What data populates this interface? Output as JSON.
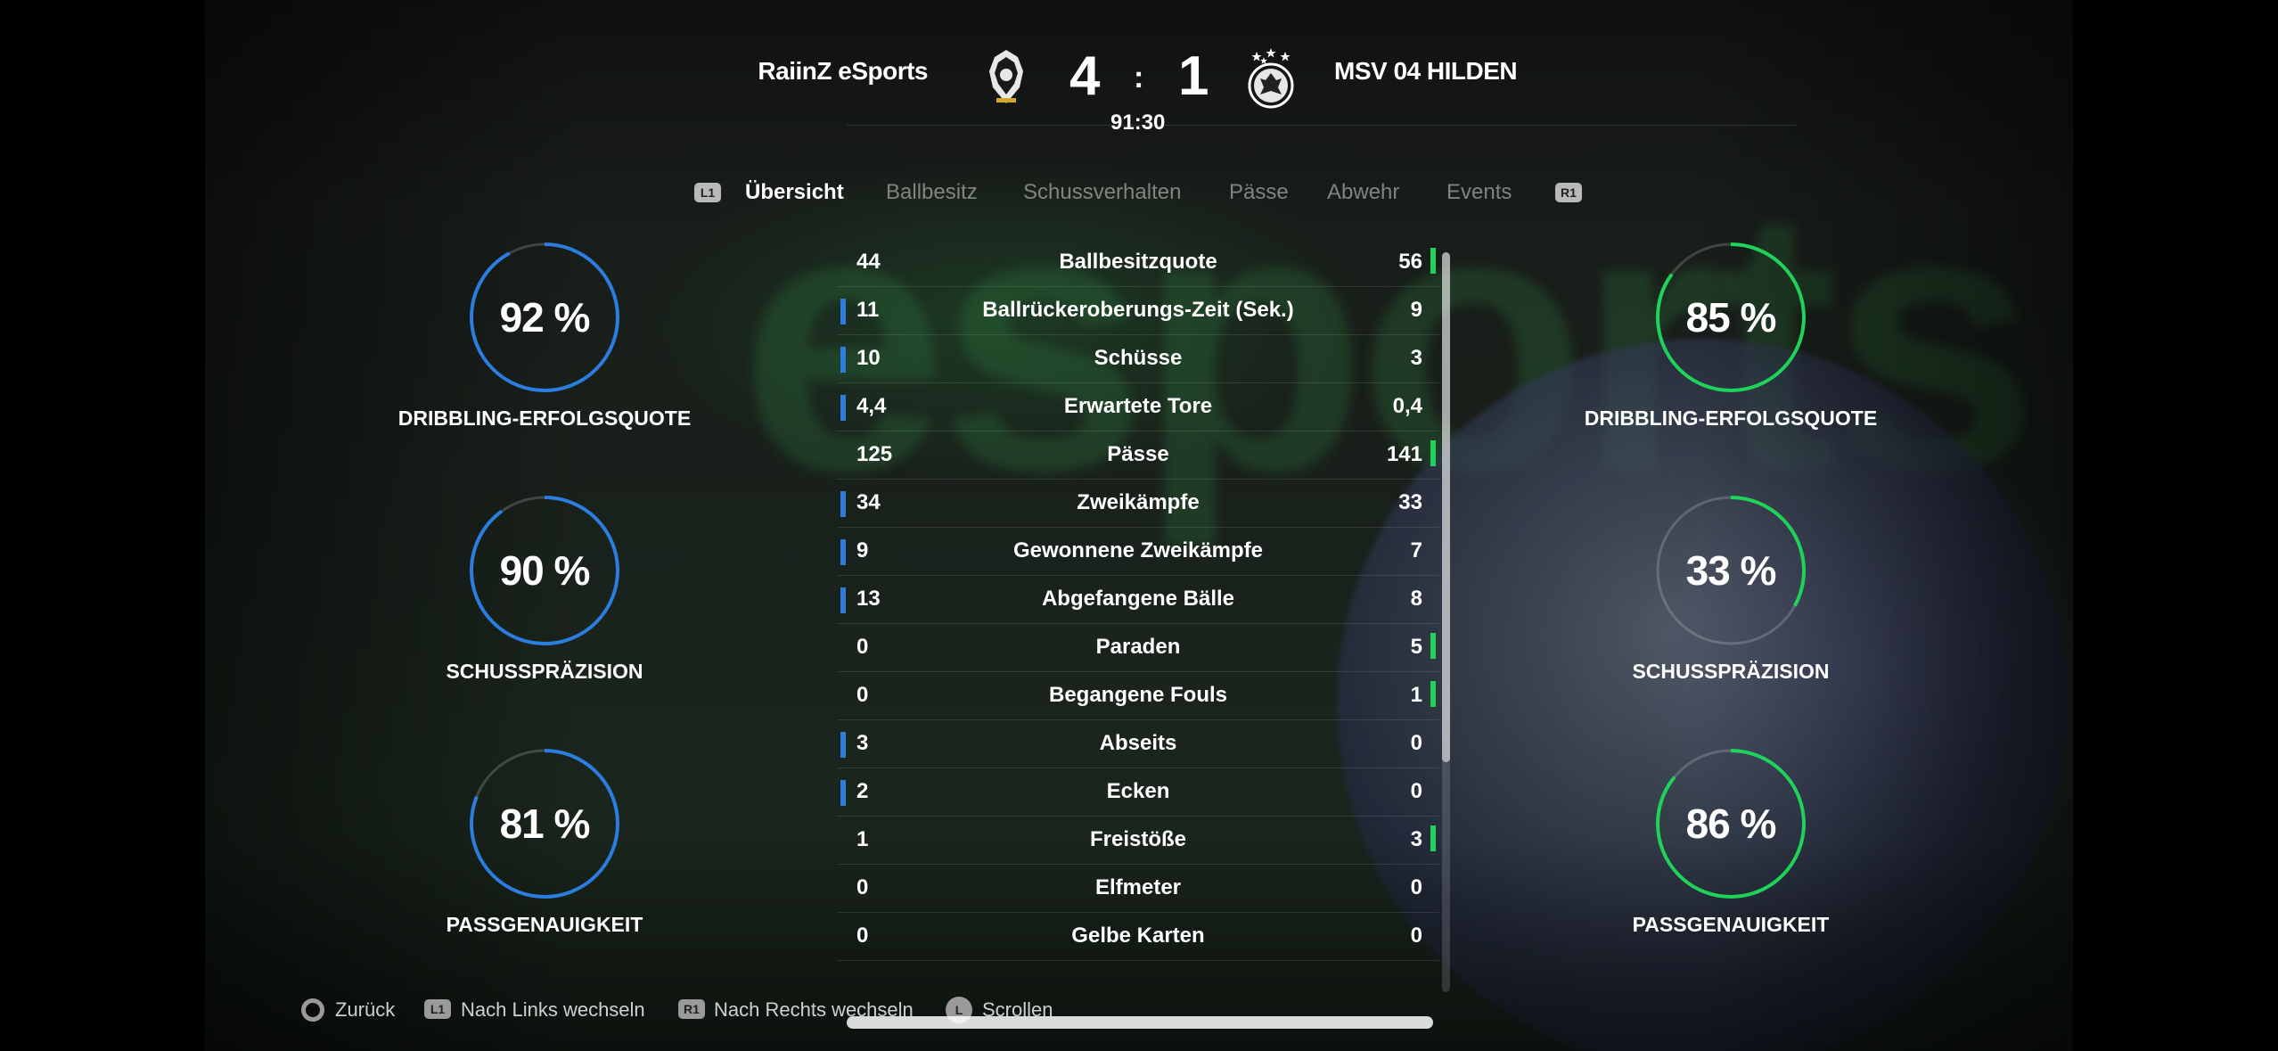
{
  "header": {
    "home_team": "RaiinZ eSports",
    "away_team": "MSV 04 HILDEN",
    "home_score": "4",
    "away_score": "1",
    "separator": ":",
    "clock": "91:30"
  },
  "tabs": {
    "left_button": "L1",
    "right_button": "R1",
    "items": [
      "Übersicht",
      "Ballbesitz",
      "Schussverhalten",
      "Pässe",
      "Abwehr",
      "Events"
    ],
    "active": "Übersicht"
  },
  "left_rings": [
    {
      "value": "92 %",
      "fraction": 0.92,
      "label": "DRIBBLING-ERFOLGSQUOTE"
    },
    {
      "value": "90 %",
      "fraction": 0.9,
      "label": "SCHUSSPRÄZISION"
    },
    {
      "value": "81 %",
      "fraction": 0.81,
      "label": "PASSGENAUIGKEIT"
    }
  ],
  "right_rings": [
    {
      "value": "85 %",
      "fraction": 0.85,
      "label": "DRIBBLING-ERFOLGSQUOTE"
    },
    {
      "value": "33 %",
      "fraction": 0.33,
      "label": "SCHUSSPRÄZISION"
    },
    {
      "value": "86 %",
      "fraction": 0.86,
      "label": "PASSGENAUIGKEIT"
    }
  ],
  "stats": [
    {
      "home": "44",
      "name": "Ballbesitzquote",
      "away": "56",
      "leader": "away"
    },
    {
      "home": "11",
      "name": "Ballrückeroberungs-Zeit (Sek.)",
      "away": "9",
      "leader": "home"
    },
    {
      "home": "10",
      "name": "Schüsse",
      "away": "3",
      "leader": "home"
    },
    {
      "home": "4,4",
      "name": "Erwartete Tore",
      "away": "0,4",
      "leader": "home"
    },
    {
      "home": "125",
      "name": "Pässe",
      "away": "141",
      "leader": "away"
    },
    {
      "home": "34",
      "name": "Zweikämpfe",
      "away": "33",
      "leader": "home"
    },
    {
      "home": "9",
      "name": "Gewonnene Zweikämpfe",
      "away": "7",
      "leader": "home"
    },
    {
      "home": "13",
      "name": "Abgefangene Bälle",
      "away": "8",
      "leader": "home"
    },
    {
      "home": "0",
      "name": "Paraden",
      "away": "5",
      "leader": "away"
    },
    {
      "home": "0",
      "name": "Begangene Fouls",
      "away": "1",
      "leader": "away"
    },
    {
      "home": "3",
      "name": "Abseits",
      "away": "0",
      "leader": "home"
    },
    {
      "home": "2",
      "name": "Ecken",
      "away": "0",
      "leader": "home"
    },
    {
      "home": "1",
      "name": "Freistöße",
      "away": "3",
      "leader": "away"
    },
    {
      "home": "0",
      "name": "Elfmeter",
      "away": "0",
      "leader": "none"
    },
    {
      "home": "0",
      "name": "Gelbe Karten",
      "away": "0",
      "leader": "none"
    }
  ],
  "footer": {
    "back": "Zurück",
    "left_switch": "Nach Links wechseln",
    "right_switch": "Nach Rechts wechseln",
    "scroll": "Scrollen",
    "l1": "L1",
    "r1": "R1",
    "l": "L"
  },
  "colors": {
    "home": "#2b7de0",
    "away": "#1fd25a"
  }
}
